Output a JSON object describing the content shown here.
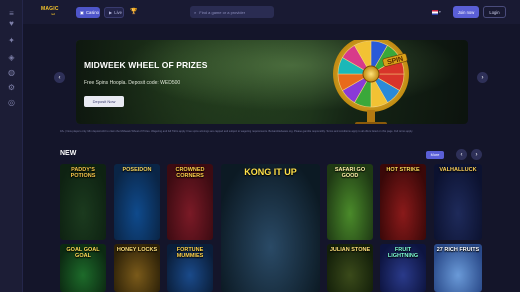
{
  "rail": {
    "items": [
      {
        "icon": "menu-icon",
        "glyph": "≡"
      },
      {
        "icon": "heart-icon",
        "glyph": "♥"
      },
      {
        "icon": "gift-icon",
        "glyph": "✦"
      },
      {
        "icon": "promo-icon",
        "glyph": "◈"
      },
      {
        "icon": "chat-icon",
        "glyph": "◍"
      },
      {
        "icon": "settings-icon",
        "glyph": "⚙"
      },
      {
        "icon": "support-icon",
        "glyph": "◎"
      }
    ]
  },
  "header": {
    "logo_text": "MAGIC",
    "logo_sub": "red",
    "tabs": [
      {
        "label": "Casino",
        "icon": "slot-icon"
      },
      {
        "label": "Live",
        "icon": "live-icon"
      }
    ],
    "trophy_icon": "trophy-icon",
    "search_placeholder": "Find a game or a provider",
    "language": "EN",
    "join_label": "Join now",
    "login_label": "Login"
  },
  "banner": {
    "title": "MIDWEEK WHEEL OF PRIZES",
    "subtitle": "Free Spins Hoopla. Deposit code: WED500",
    "button": "Deposit Now",
    "wheel_label": "SPIN",
    "disclaimer": "18+ | New players only. Min deposit £10 to claim the Midweek Wheel of Prizes. Wagering and full T&Cs apply. Free spins winnings are capped and subject to wagering requirements. BeGambleAware.org. Please gamble responsibly. Terms and conditions apply to all offers listed on this page. Full terms apply."
  },
  "new_section": {
    "title": "NEW",
    "more_label": "More",
    "games": [
      {
        "name": "PADDY'S POTIONS",
        "top": "#1b3a1e",
        "bottom": "#0e2212",
        "text": "#f6c64a"
      },
      {
        "name": "POSEIDON",
        "top": "#0f4a8c",
        "bottom": "#0a2546",
        "text": "#f4d35e"
      },
      {
        "name": "CROWNED CORNERS",
        "top": "#7a1a26",
        "bottom": "#3c0b12",
        "text": "#ffd24a"
      },
      {
        "name": "KONG IT UP",
        "top": "#2a4a66",
        "bottom": "#0c1a24",
        "text": "#ffe14a"
      },
      {
        "name": "SAFARI GO GOOD",
        "top": "#4a8a2a",
        "bottom": "#1f3a14",
        "text": "#fff1a8"
      },
      {
        "name": "HOT STRIKE",
        "top": "#8a1a1a",
        "bottom": "#3a0808",
        "text": "#ffde59"
      },
      {
        "name": "VALHALLUCK",
        "top": "#1e2a5a",
        "bottom": "#0c1230",
        "text": "#ffd35a"
      },
      {
        "name": "GOAL GOAL GOAL",
        "top": "#1d6b2a",
        "bottom": "#0c2a12",
        "text": "#ffdd57"
      },
      {
        "name": "HONEY LOCKS",
        "top": "#7a5a1a",
        "bottom": "#2e2208",
        "text": "#ffe07a"
      },
      {
        "name": "FORTUNE MUMMIES",
        "top": "#1a4a8a",
        "bottom": "#0a1e3a",
        "text": "#ffd24a"
      },
      {
        "name": "JULIAN STONE",
        "top": "#3a4a1a",
        "bottom": "#14200a",
        "text": "#ffe07a"
      },
      {
        "name": "FRUIT LIGHTNING",
        "top": "#2a3a8a",
        "bottom": "#0d1440",
        "text": "#7fffd4"
      },
      {
        "name": "27 RICH FRUITS",
        "top": "#6a9ad8",
        "bottom": "#2a4a8a",
        "text": "#fff"
      }
    ]
  },
  "colors": {
    "accent": "#5a5fd6",
    "page_bg": "#14152a"
  }
}
